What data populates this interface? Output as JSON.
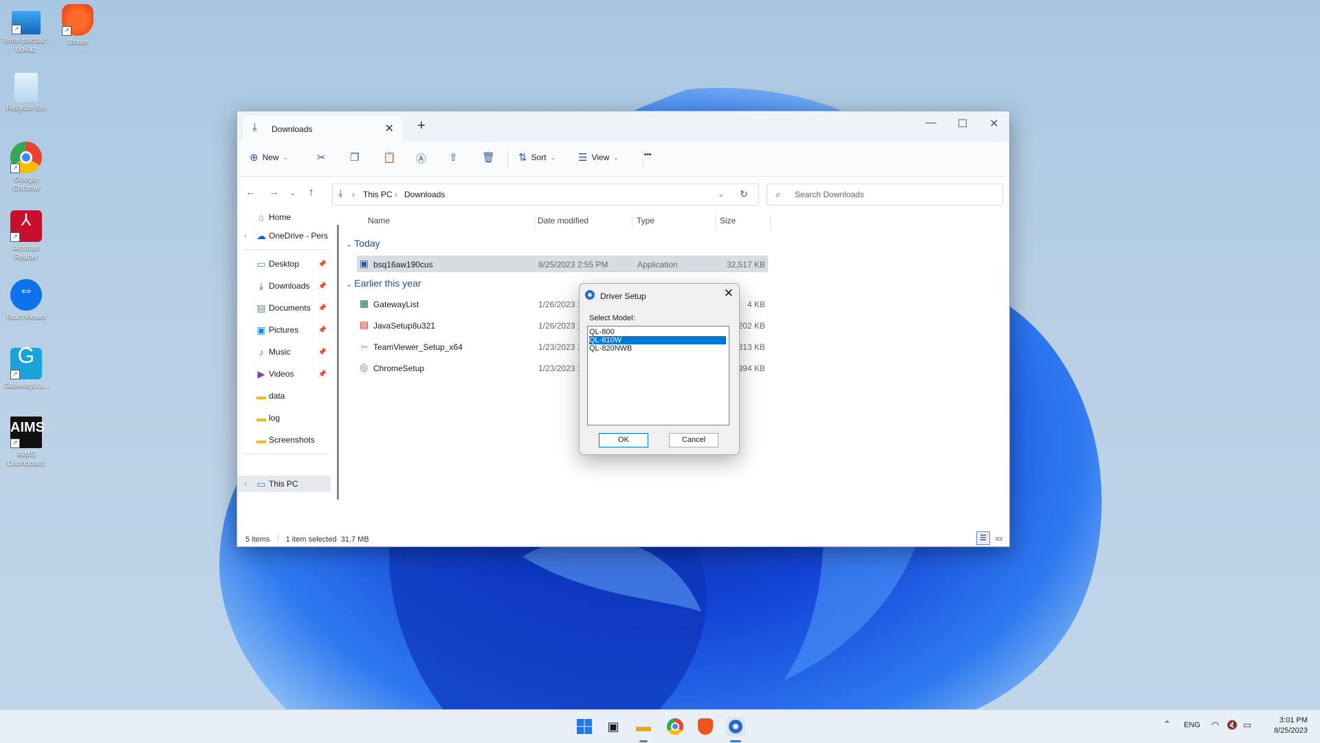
{
  "desktop": {
    "icons": [
      {
        "label": "Tento počítač - odkaz",
        "icon": "monitor-icon"
      },
      {
        "label": "Brave",
        "icon": "brave-icon"
      },
      {
        "label": "Recycle Bin",
        "icon": "recycle-bin-icon"
      },
      {
        "label": "Google Chrome",
        "icon": "chrome-icon"
      },
      {
        "label": "Acrobat Reader",
        "icon": "acrobat-icon"
      },
      {
        "label": "TeamViewer",
        "icon": "teamviewer-icon"
      },
      {
        "label": "GatewayLa...",
        "icon": "gateway-icon"
      },
      {
        "label": "AIMS Dashboard",
        "icon": "aims-icon"
      }
    ],
    "aims_logo_text": "AIMS",
    "gateway_logo_text": "G"
  },
  "explorer": {
    "tab_title": "Downloads",
    "toolbar": {
      "new": "New",
      "sort": "Sort",
      "view": "View",
      "more": "•••"
    },
    "breadcrumb": [
      "This PC",
      "Downloads"
    ],
    "search_placeholder": "Search Downloads",
    "sidebar": {
      "home": "Home",
      "onedrive": "OneDrive - Pers",
      "desktop": "Desktop",
      "downloads": "Downloads",
      "documents": "Documents",
      "pictures": "Pictures",
      "music": "Music",
      "videos": "Videos",
      "data": "data",
      "log": "log",
      "screenshots": "Screenshots",
      "thispc": "This PC"
    },
    "columns": {
      "name": "Name",
      "date": "Date modified",
      "type": "Type",
      "size": "Size"
    },
    "groups": {
      "today": "Today",
      "earlier": "Earlier this year"
    },
    "files_today": [
      {
        "name": "bsq16aw190cus",
        "date": "8/25/2023 2:55 PM",
        "type": "Application",
        "size": "32,517 KB"
      }
    ],
    "files_earlier": [
      {
        "name": "GatewayList",
        "date": "1/26/2023 1",
        "size": "4 KB"
      },
      {
        "name": "JavaSetup8u321",
        "date": "1/26/2023 1",
        "size": "202 KB"
      },
      {
        "name": "TeamViewer_Setup_x64",
        "date": "1/23/2023 1",
        "size": "313 KB"
      },
      {
        "name": "ChromeSetup",
        "date": "1/23/2023 1",
        "size": "394 KB"
      }
    ],
    "status": {
      "items": "5 items",
      "selected": "1 item selected  31.7 MB"
    }
  },
  "dialog": {
    "title": "Driver Setup",
    "label": "Select Model:",
    "options": [
      "QL-800",
      "QL-810W",
      "QL-820NWB"
    ],
    "selected": "QL-810W",
    "ok": "OK",
    "cancel": "Cancel"
  },
  "taskbar": {
    "lang": "ENG",
    "time": "3:01 PM",
    "date": "8/25/2023"
  },
  "colors": {
    "accent": "#0078d7",
    "group_header": "#1f4f8f",
    "taskbar": "#e9eff6"
  }
}
